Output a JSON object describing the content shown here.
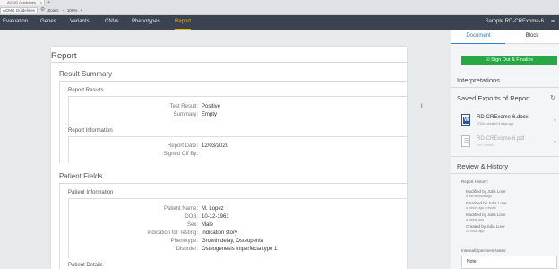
{
  "browser": {
    "tab_title": "ACMG Guidelines",
    "tab_close": "×",
    "new_tab": "+",
    "bookmark": "ACMG Guidelines",
    "zoom_label": "Zoom:",
    "zoom_minus": "−",
    "zoom_value": "100%",
    "zoom_plus": "+"
  },
  "nav": {
    "items": [
      "Evaluation",
      "Genes",
      "Variants",
      "CNVs",
      "Phenotypes",
      "Report"
    ],
    "active": "Report",
    "sample": "Sample RD-CRExome-6",
    "menu_icon": "≡",
    "accent": "#f0b400",
    "bg": "#3b4250"
  },
  "report": {
    "title": "Report",
    "result_summary": {
      "title": "Result Summary",
      "report_results": {
        "title": "Report Results",
        "fields": [
          {
            "label": "Test Result:",
            "value": "Positive"
          },
          {
            "label": "Summary:",
            "value": "Empty"
          }
        ]
      },
      "report_information": {
        "title": "Report Information",
        "fields": [
          {
            "label": "Report Date:",
            "value": "12/03/2020"
          },
          {
            "label": "Signed Off By:",
            "value": ""
          }
        ]
      }
    },
    "patient_fields": {
      "title": "Patient Fields",
      "patient_information": {
        "title": "Patient Information",
        "fields": [
          {
            "label": "Patient Name:",
            "value": "M. Lopez"
          },
          {
            "label": "DOB:",
            "value": "10-12-1961"
          },
          {
            "label": "Sex:",
            "value": "Male"
          },
          {
            "label": "Indication for Testing:",
            "value": "indication story"
          },
          {
            "label": "Phenotype:",
            "value": "Growth delay, Osteopenia"
          },
          {
            "label": "Disorder:",
            "value": "Osteogenesis imperfecta type 1"
          }
        ]
      },
      "patient_details": {
        "title": "Patient Details"
      }
    }
  },
  "side": {
    "tabs": [
      "Document",
      "Block"
    ],
    "active_tab": "Document",
    "signout_label": "☑ Sign Out & Finalize",
    "signout_color": "#27a844",
    "interpretations": "Interpretations",
    "saved_exports": {
      "title": "Saved Exports of Report",
      "refresh_icon": "↻",
      "files": [
        {
          "name": "RD-CRExome-6.docx",
          "meta": "47Gb • created 3 days ago",
          "icon": "W",
          "dim": false,
          "chevron": "⌄"
        },
        {
          "name": "RD-CRExome-6.pdf",
          "meta": "Not Created",
          "icon": "☰",
          "dim": true,
          "chevron": "⌄"
        }
      ]
    },
    "review": {
      "title": "Review & History",
      "history_label": "Report History:",
      "entries": [
        {
          "action": "Modified by Julia Love",
          "when": "a few seconds ago"
        },
        {
          "action": "Finalized by Julia Love",
          "when": "a minute ago • revoke"
        },
        {
          "action": "Modified by Julia Love",
          "when": "a minute ago"
        },
        {
          "action": "Created by Julia Love",
          "when": "20 hours ago"
        }
      ],
      "notes_label": "Internal/Specimen Notes:",
      "notes_value": "Note"
    }
  }
}
